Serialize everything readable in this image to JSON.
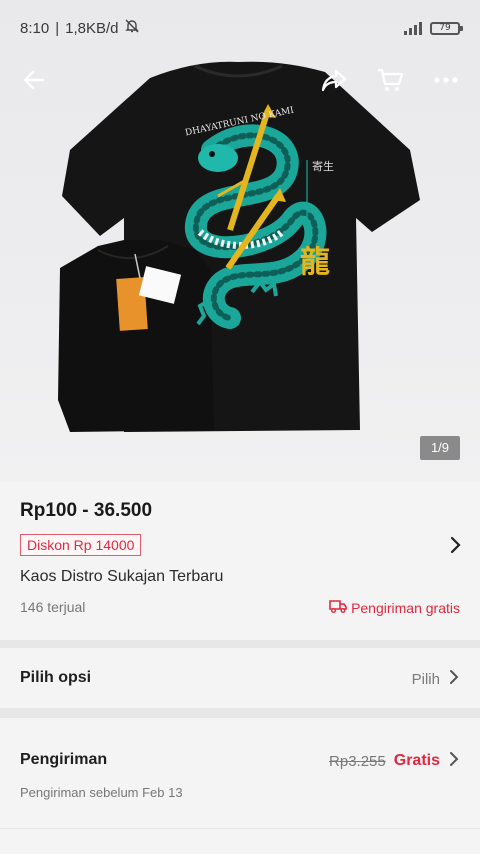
{
  "status": {
    "time": "8:10",
    "speed": "1,8KB/d",
    "battery": "79"
  },
  "header": {
    "icons": [
      "back-arrow-icon",
      "share-icon",
      "cart-icon",
      "more-icon"
    ]
  },
  "gallery": {
    "page": "1/9",
    "print_text": "DHAYATRUNI NO KAMI",
    "kanji": "龍"
  },
  "product": {
    "price": "Rp100 - 36.500",
    "discount": "Diskon Rp 14000",
    "title": "Kaos Distro Sukajan Terbaru",
    "sold": "146 terjual",
    "shipping_badge": "Pengiriman gratis"
  },
  "options": {
    "label": "Pilih opsi",
    "action": "Pilih"
  },
  "shipping": {
    "label": "Pengiriman",
    "old_price": "Rp3.255",
    "new_price": "Gratis",
    "eta": "Pengiriman sebelum Feb 13"
  },
  "colors": {
    "accent_red": "#e2283f",
    "teal": "#1aa79a",
    "gold": "#e3b51e"
  }
}
